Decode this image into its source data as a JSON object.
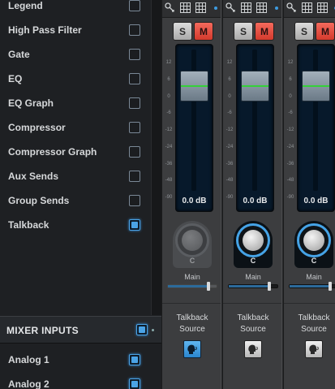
{
  "options": {
    "items": [
      {
        "label": "Legend",
        "checked": false
      },
      {
        "label": "High Pass Filter",
        "checked": false
      },
      {
        "label": "Gate",
        "checked": false
      },
      {
        "label": "EQ",
        "checked": false
      },
      {
        "label": "EQ Graph",
        "checked": false
      },
      {
        "label": "Compressor",
        "checked": false
      },
      {
        "label": "Compressor Graph",
        "checked": false
      },
      {
        "label": "Aux Sends",
        "checked": false
      },
      {
        "label": "Group Sends",
        "checked": false
      },
      {
        "label": "Talkback",
        "checked": true
      }
    ]
  },
  "mixer_inputs": {
    "title": "MIXER INPUTS",
    "checked": true,
    "items": [
      {
        "label": "Analog 1",
        "checked": true
      },
      {
        "label": "Analog 2",
        "checked": true
      }
    ]
  },
  "strips": [
    {
      "solo": "S",
      "mute": "M",
      "level": "0.0 dB",
      "pan": "C",
      "send_label": "Main",
      "send_level": 0.85,
      "talkback_label_1": "Talkback",
      "talkback_label_2": "Source",
      "talkback_active": true,
      "dimmed": true
    },
    {
      "solo": "S",
      "mute": "M",
      "level": "0.0 dB",
      "pan": "C",
      "send_label": "Main",
      "send_level": 0.85,
      "talkback_label_1": "Talkback",
      "talkback_label_2": "Source",
      "talkback_active": false,
      "dimmed": false
    },
    {
      "solo": "S",
      "mute": "M",
      "level": "0.0 dB",
      "pan": "C",
      "send_label": "Main",
      "send_level": 0.85,
      "talkback_label_1": "Talkback",
      "talkback_label_2": "Source",
      "talkback_active": false,
      "dimmed": false
    }
  ],
  "fader_scale": [
    "12",
    "6",
    "0",
    "-6",
    "-12",
    "-24",
    "-36",
    "-48",
    "-90"
  ],
  "icons": {
    "strip_top": [
      "link-icon",
      "grid-icon",
      "status-dot-icon"
    ],
    "talkback": "talkback-head-icon"
  },
  "colors": {
    "accent": "#4aa3e6",
    "mute": "#e5473a",
    "fader_line": "#35d03a",
    "panel_bg": "#1e2023"
  }
}
